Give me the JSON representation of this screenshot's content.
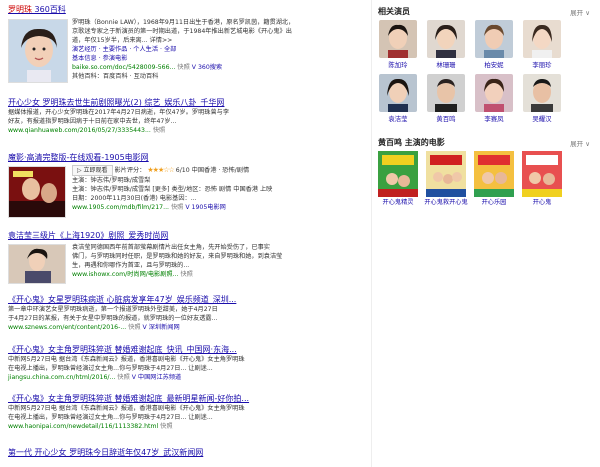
{
  "results": [
    {
      "title_parts": [
        "罗明珠",
        " 360百科"
      ],
      "snippet_lines": [
        "罗明珠（Bonnie LAW），1968年9月11日出生于香港，原名罗凯茵，籍贯湖北，",
        "京歌迷专家之于新演员的第一时期出道，于1984年推出新艺城电影《开心鬼》出",
        "道，年仅15岁半，后来离... 详情>>"
      ],
      "tags": "演艺经历 · 主要作品 · 个人生活 · 全部",
      "meta": "基本信息 · 参演电影",
      "url": "baike.so.com/doc/5428009-566...",
      "cache": "快照",
      "badge": "V 360搜索",
      "extra": "其他百科：百度百科 · 互动百科"
    },
    {
      "title": "开心少女 罗明珠去世生前剧照曝光(2) 综艺_娱乐八卦_千华网",
      "snippet_lines": [
        "据媒体报道，开心少女罗明珠在2017年4月27日病逝，年仅47岁。罗明珠曾与李",
        "好友，有报道指罗明珠因病于十日前在家中去世，终年47岁..."
      ],
      "url": "www.qianhuaweb.com/2016/05/27/3335443...",
      "cache": "快照"
    },
    {
      "title": "魔影·高清完整版-在线观看-1905电影网",
      "play_label": "▷ 立即观看",
      "rating_label": "影片评分：",
      "rating_value": "6/10",
      "genre": "中国香港 · 恐怖/剧情",
      "info_lines": [
        "主演：钟志伟/罗明珠/成雪梨",
        "主演：钟志伟/罗明珠/成雪梨 [更多] 类型/地区：恐怖 剧情 中国香港 上映",
        "日期：2000年11月30日(香港) 电影基因：..."
      ],
      "url": "www.1905.com/mdb/film/217...",
      "cache": "快照",
      "badge": "V 1905电影网"
    },
    {
      "title": "袁洁莹三级片《上海1920》剧照_爱秀时尚网",
      "snippet_lines": [
        "袁洁莹同德国西年前首部萤幕剧情片出任女主角，先开始受伤了，已事实",
        "佛门，与罗明珠同时任职，是罗明珠和她的好友，来自罗明珠和她，到袁洁莹",
        "生，再遇和你哪作为首亚，且与罗明珠的..."
      ],
      "url": "www.ishowx.com/时尚网/电影剧照...",
      "cache": "快照"
    },
    {
      "title": "《开心鬼》女星罗明珠病逝 心脏病发享年47岁_娱乐频道_深圳...",
      "snippet_lines": [
        "第一章中环演艺女星罗明珠病逝，第一个报道罗明珠外型甜美，她于4月27日",
        "于4月27日的某报，有关于女星中罗明珠的报道，就罗明珠的一位好友透露..."
      ],
      "url": "www.sznews.com/ent/content/2016-...",
      "cache": "快照",
      "badge": "V 深圳新闻网"
    },
    {
      "title": "《开心鬼》女主角罗明珠猝逝 替婚难谢起底_快讯_中国网·东海...",
      "snippet_lines": [
        "中新网5月27日电 据台湾《东森新闻云》报道，香港喜剧电影《开心鬼》女主角罗明珠",
        "在电视上播出，罗明珠曾经演过女主角...你与罗明珠于4月27日... 让剧迷..."
      ],
      "url": "jiangsu.china.com.cn/html/2016/...",
      "cache": "快照",
      "badge": "V 中国网江苏频道"
    },
    {
      "title": "《开心鬼》女主角罗明珠猝逝 替婚难谢起底_最新明星新闻-好你拍...",
      "snippet_lines": [
        "中新网5月27日电 据台湾《东森新闻云》报道，香港喜剧电影《开心鬼》女主角罗明珠",
        "在电视上播出，罗明珠曾经演过女主角...你与罗明珠于4月27日... 让剧迷..."
      ],
      "url": "www.haonipai.com/newdetail/116/1113382.html",
      "cache": "快照"
    },
    {
      "title": "第一代 开心少女 罗明珠今日辞逝年仅47岁_武汉新闻网"
    }
  ],
  "sidebar": {
    "actors_title": "相关演员",
    "more": "展开",
    "actors": [
      "陈加玲",
      "林珊珊",
      "柏安妮",
      "李丽珍",
      "袁洁莹",
      "黄百鸣",
      "李赛凤",
      "吴耀汉"
    ],
    "movies_title": "黄百鸣 主演的电影",
    "movies": [
      "开心鬼精灵",
      "开心鬼救开心鬼",
      "开心乐园",
      "开心鬼"
    ]
  },
  "colors": {
    "link": "#1a0dab",
    "highlight": "#cc0000",
    "url": "#008000"
  }
}
